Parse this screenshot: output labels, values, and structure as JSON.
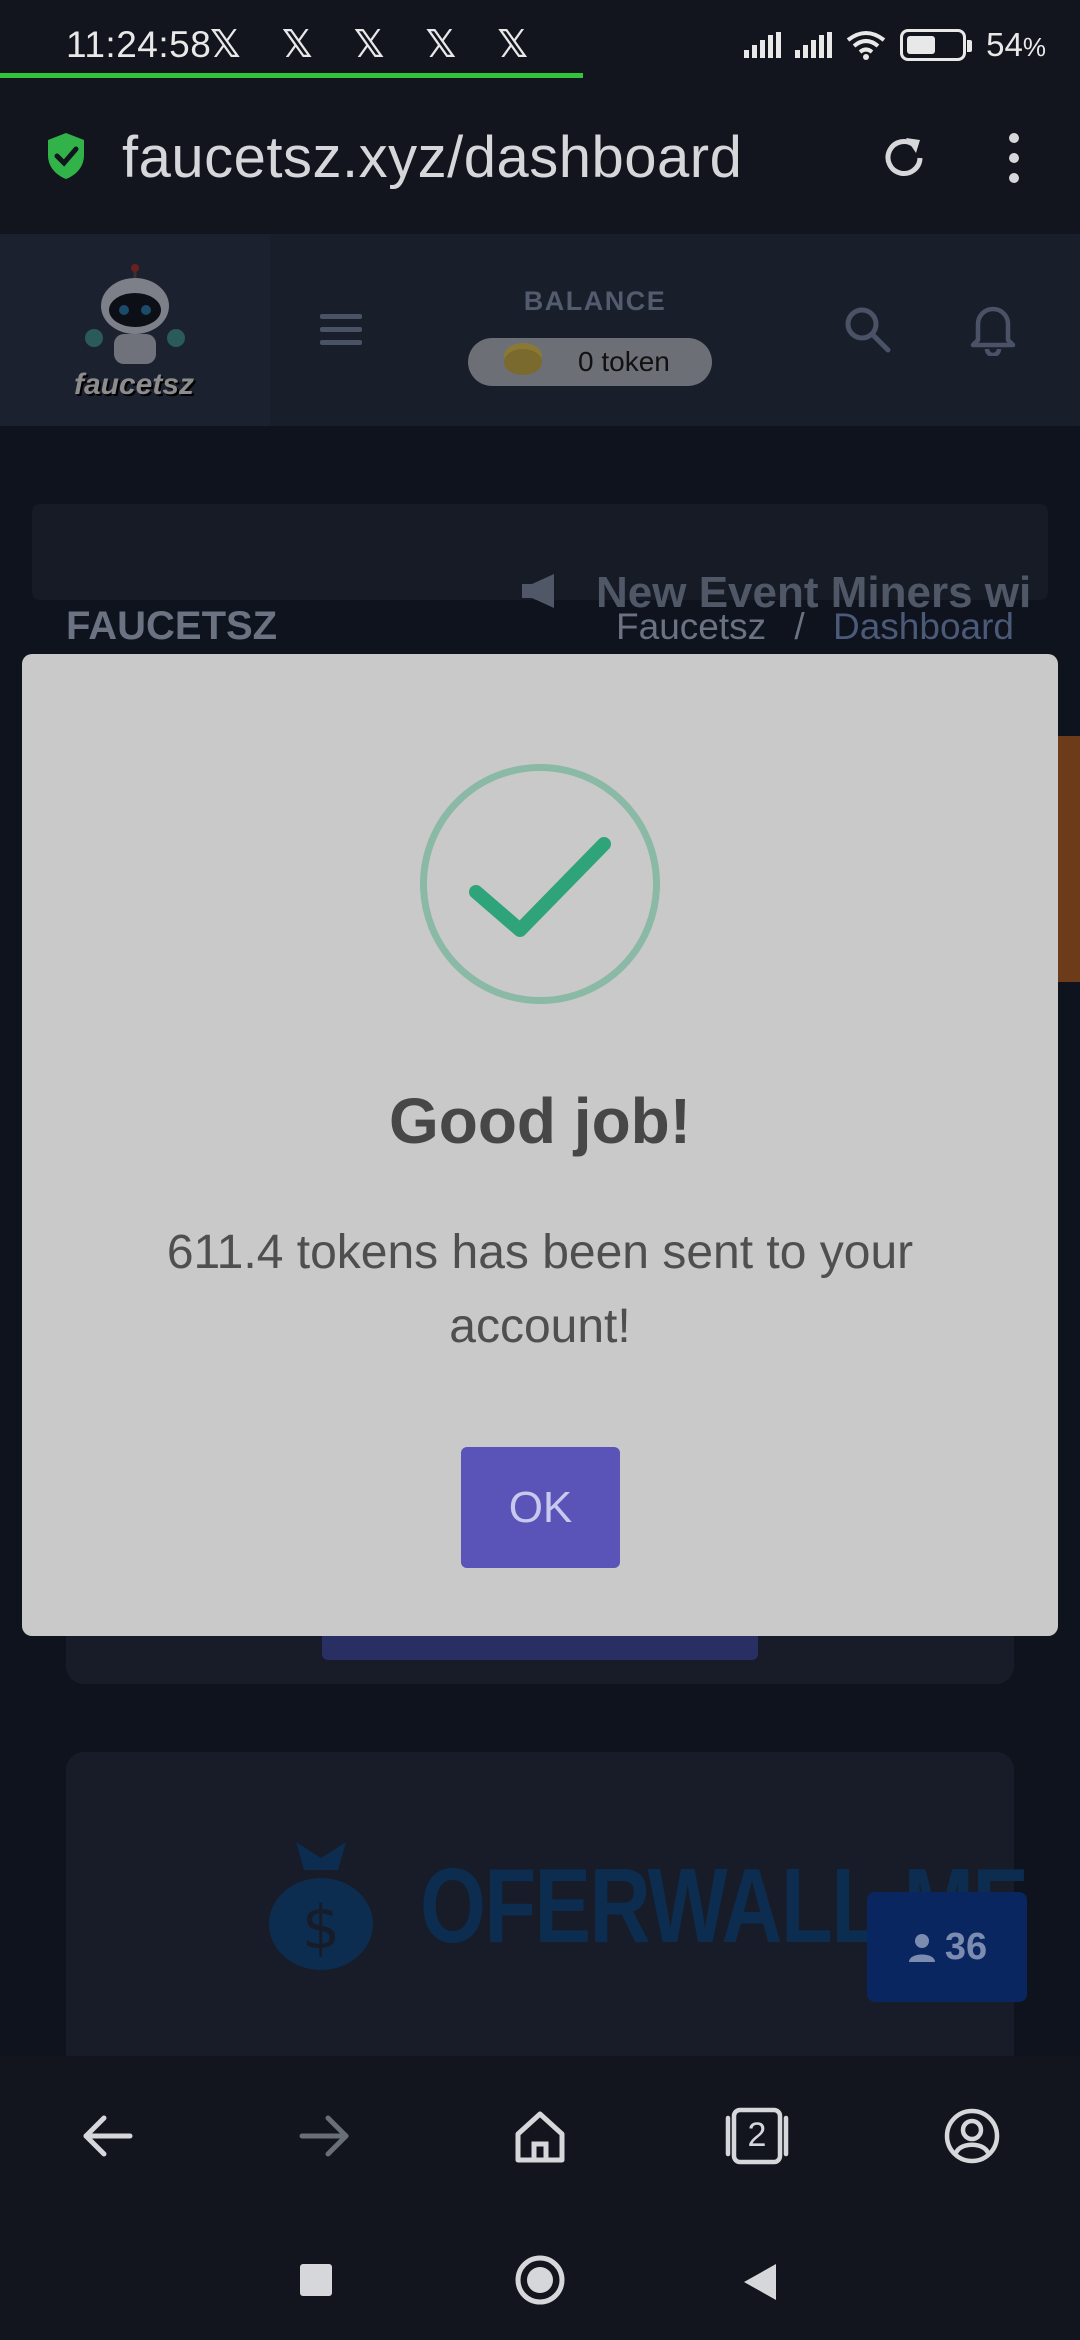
{
  "status_bar": {
    "time": "11:24:58",
    "notif_icons": "𝕏 𝕏 𝕏 𝕏 𝕏",
    "battery_percent": "54",
    "battery_unit": "%"
  },
  "browser": {
    "url": "faucetsz.xyz/dashboard",
    "page_load_progress": 0.54,
    "tab_count": "2"
  },
  "site_header": {
    "logo_text": "faucetsz",
    "balance_label": "BALANCE",
    "balance_value": "0 token"
  },
  "page": {
    "ticker": "New Event Miners wi",
    "heading": "FAUCETSZ",
    "breadcrumb": {
      "root": "Faucetsz",
      "separator": "/",
      "current": "Dashboard"
    },
    "offerwall_logo_text": "OFERWALL.ME",
    "online_users": "36"
  },
  "modal": {
    "icon": "success-check-icon",
    "title": "Good job!",
    "message": "611.4 tokens has been sent to your account!",
    "ok_label": "OK"
  },
  "colors": {
    "success": "#2fa37a",
    "ok_button": "#5a53b8",
    "load_bar": "#32c43b"
  }
}
